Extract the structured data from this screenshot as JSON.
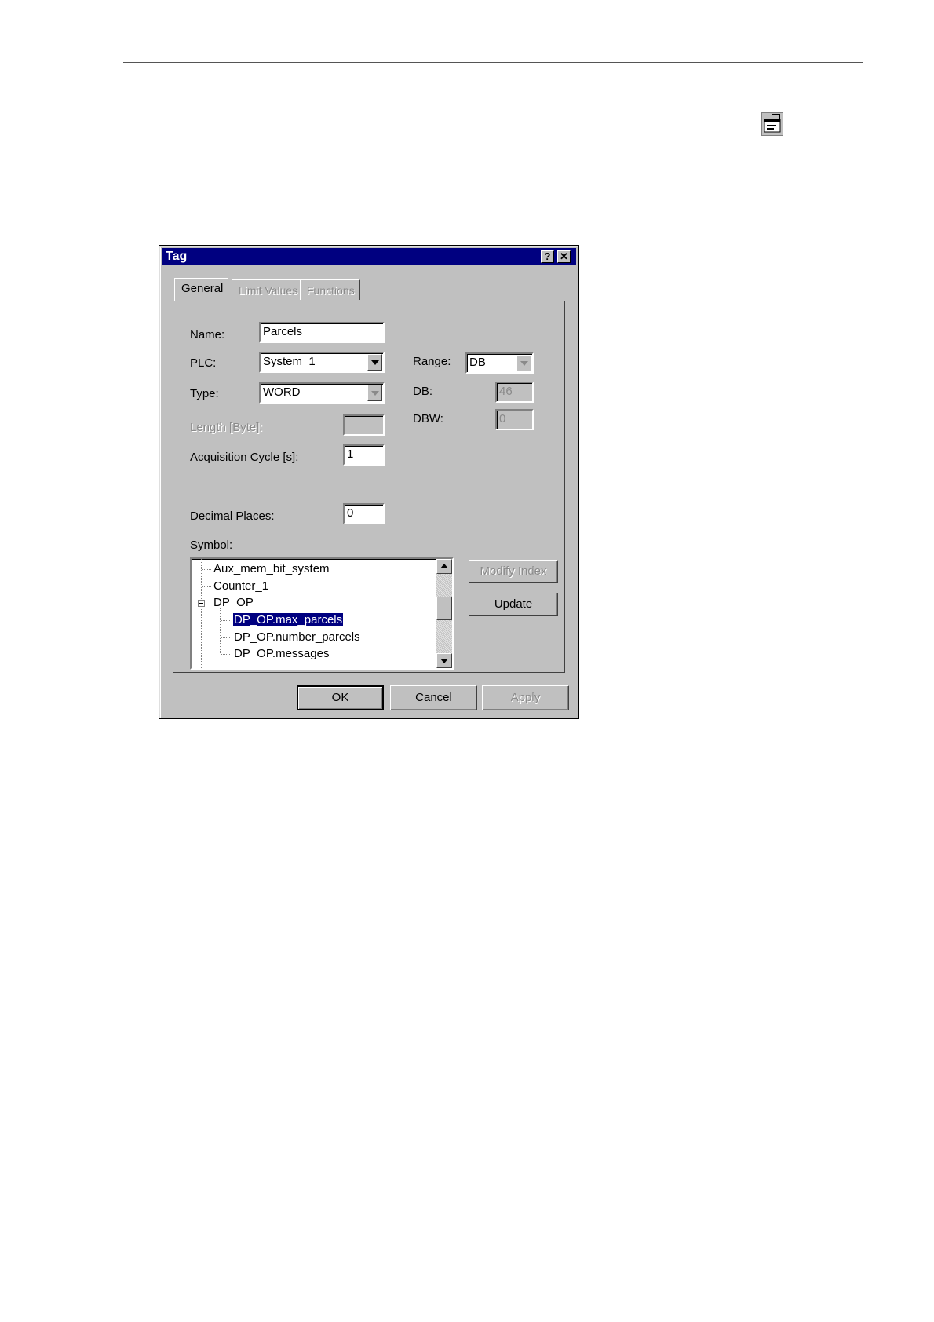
{
  "page": {
    "header_rule": true
  },
  "toolbar_icon": {
    "name": "properties-icon"
  },
  "dialog": {
    "title": "Tag",
    "help_glyph": "?",
    "close_glyph": "✕",
    "tabs": [
      {
        "label": "General",
        "enabled": true,
        "active": true
      },
      {
        "label": "Limit Values",
        "enabled": false
      },
      {
        "label": "Functions",
        "enabled": false
      }
    ],
    "fields": {
      "name": {
        "label": "Name:",
        "value": "Parcels"
      },
      "plc": {
        "label": "PLC:",
        "value": "System_1"
      },
      "type": {
        "label": "Type:",
        "value": "WORD"
      },
      "length": {
        "label": "Length [Byte]:",
        "value": ""
      },
      "acq_cycle": {
        "label": "Acquisition Cycle [s]:",
        "value": "1"
      },
      "decimal_places": {
        "label": "Decimal Places:",
        "value": "0"
      },
      "range": {
        "label": "Range:",
        "value": "DB"
      },
      "db": {
        "label": "DB:",
        "value": "46"
      },
      "dbw": {
        "label": "DBW:",
        "value": "0"
      }
    },
    "symbol": {
      "label": "Symbol:",
      "items": [
        {
          "label": "Aux_mem_bit_system",
          "level": 0
        },
        {
          "label": "Counter_1",
          "level": 0
        },
        {
          "label": "DP_OP",
          "level": 0,
          "expanded": true
        },
        {
          "label": "DP_OP.max_parcels",
          "level": 1,
          "selected": true
        },
        {
          "label": "DP_OP.number_parcels",
          "level": 1
        },
        {
          "label": "DP_OP.messages",
          "level": 1
        }
      ]
    },
    "buttons": {
      "modify_index": "Modify Index",
      "update": "Update",
      "ok": "OK",
      "cancel": "Cancel",
      "apply": "Apply"
    }
  }
}
